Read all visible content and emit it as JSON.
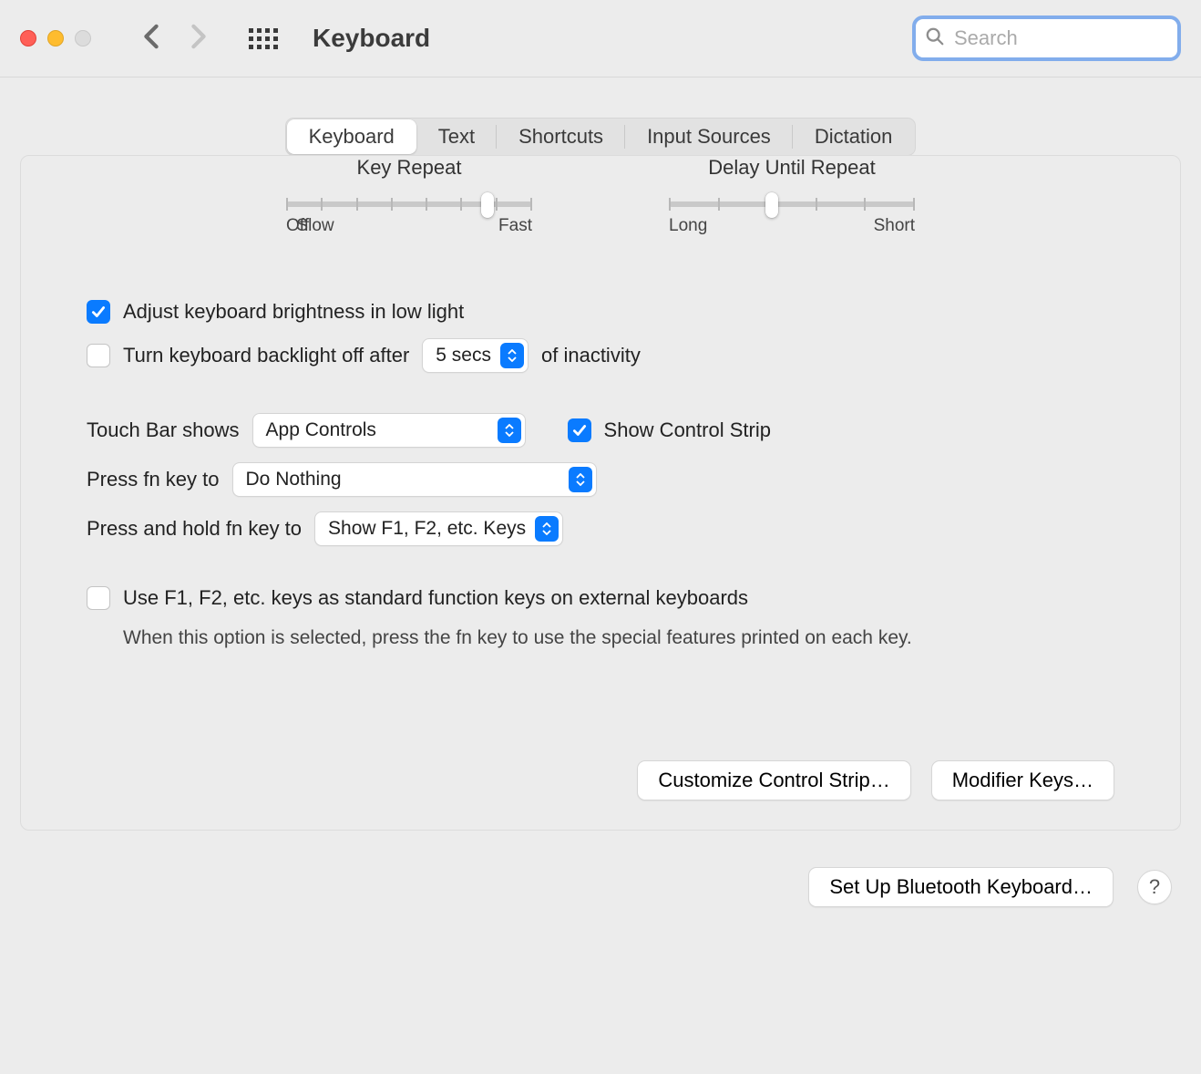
{
  "title": "Keyboard",
  "search": {
    "placeholder": "Search"
  },
  "tabs": [
    "Keyboard",
    "Text",
    "Shortcuts",
    "Input Sources",
    "Dictation"
  ],
  "active_tab": 0,
  "sliders": {
    "key_repeat": {
      "title": "Key Repeat",
      "left": "Off",
      "mid": "Slow",
      "right": "Fast"
    },
    "delay": {
      "title": "Delay Until Repeat",
      "left": "Long",
      "right": "Short"
    }
  },
  "options": {
    "adjust_brightness": "Adjust keyboard brightness in low light",
    "backlight_off_prefix": "Turn keyboard backlight off after",
    "backlight_off_value": "5 secs",
    "backlight_off_suffix": "of inactivity",
    "touchbar_label": "Touch Bar shows",
    "touchbar_value": "App Controls",
    "show_control_strip": "Show Control Strip",
    "press_fn_label": "Press fn key to",
    "press_fn_value": "Do Nothing",
    "hold_fn_label": "Press and hold fn key to",
    "hold_fn_value": "Show F1, F2, etc. Keys",
    "use_fkeys": "Use F1, F2, etc. keys as standard function keys on external keyboards",
    "use_fkeys_hint": "When this option is selected, press the fn key to use the special features printed on each key."
  },
  "buttons": {
    "customize": "Customize Control Strip…",
    "modifier": "Modifier Keys…",
    "bluetooth": "Set Up Bluetooth Keyboard…",
    "help": "?"
  }
}
